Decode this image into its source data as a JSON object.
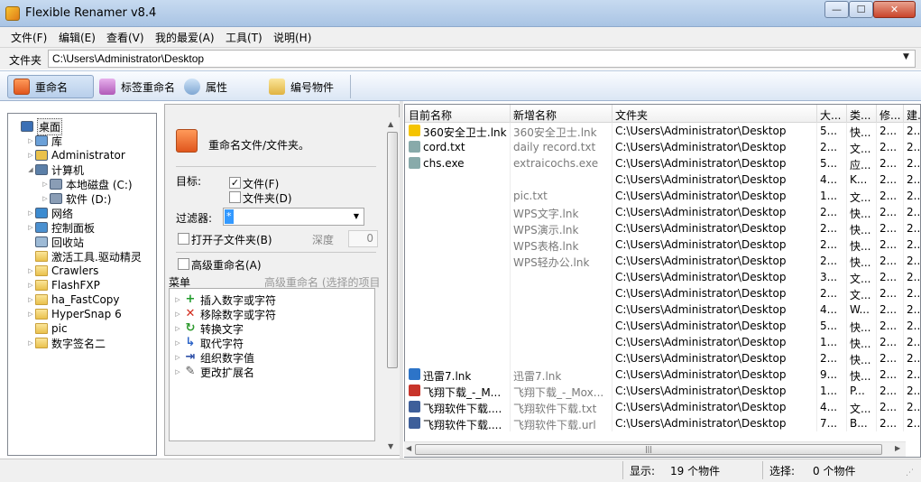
{
  "window": {
    "title": "Flexible Renamer v8.4",
    "min": "—",
    "max": "☐",
    "close": "✕"
  },
  "menu": [
    "文件(F)",
    "编辑(E)",
    "查看(V)",
    "我的最爱(A)",
    "工具(T)",
    "说明(H)"
  ],
  "address": {
    "label": "文件夹",
    "value": "C:\\Users\\Administrator\\Desktop"
  },
  "toolbar": {
    "rename": "重命名",
    "tag_rename": "标签重命名",
    "attributes": "属性",
    "number_items": "编号物件"
  },
  "tree": [
    {
      "label": "桌面",
      "level": 0,
      "expander": "",
      "icon": "desktop-icon"
    },
    {
      "label": "库",
      "level": 1,
      "expander": "▷",
      "icon": "library-icon"
    },
    {
      "label": "Administrator",
      "level": 1,
      "expander": "▷",
      "icon": "user-folder-icon"
    },
    {
      "label": "计算机",
      "level": 1,
      "expander": "◢",
      "icon": "computer-icon"
    },
    {
      "label": "本地磁盘 (C:)",
      "level": 2,
      "expander": "▷",
      "icon": "drive-c-icon"
    },
    {
      "label": "软件 (D:)",
      "level": 2,
      "expander": "▷",
      "icon": "drive-d-icon"
    },
    {
      "label": "网络",
      "level": 1,
      "expander": "▷",
      "icon": "network-icon"
    },
    {
      "label": "控制面板",
      "level": 1,
      "expander": "▷",
      "icon": "control-panel-icon"
    },
    {
      "label": "回收站",
      "level": 1,
      "expander": "",
      "icon": "recycle-bin-icon"
    },
    {
      "label": "激活工具.驱动精灵",
      "level": 1,
      "expander": "",
      "icon": "folder-icon"
    },
    {
      "label": "Crawlers",
      "level": 1,
      "expander": "▷",
      "icon": "folder-icon"
    },
    {
      "label": "FlashFXP",
      "level": 1,
      "expander": "▷",
      "icon": "folder-icon"
    },
    {
      "label": "ha_FastCopy",
      "level": 1,
      "expander": "▷",
      "icon": "folder-icon"
    },
    {
      "label": "HyperSnap 6",
      "level": 1,
      "expander": "▷",
      "icon": "folder-icon"
    },
    {
      "label": "pic",
      "level": 1,
      "expander": "",
      "icon": "folder-icon"
    },
    {
      "label": "数字签名二",
      "level": 1,
      "expander": "▷",
      "icon": "folder-icon"
    }
  ],
  "panel": {
    "heading": "重命名文件/文件夹。",
    "target_label": "目标:",
    "file_option": "文件(F)",
    "file_checked": true,
    "folder_option": "文件夹(D)",
    "folder_checked": false,
    "filter_label": "过滤器:",
    "filter_value": "*",
    "subfolders_label": "打开子文件夹(B)",
    "depth_label": "深度",
    "depth_value": "0",
    "advanced_label": "高级重命名(A)",
    "menu_label": "菜单",
    "menu_hint": "高级重命名 (选择的项目",
    "menu_items": [
      {
        "label": "插入数字或字符",
        "icon": "plus-icon",
        "glyph": "+",
        "color": "#1f9a2a"
      },
      {
        "label": "移除数字或字符",
        "icon": "remove-x-icon",
        "glyph": "✕",
        "color": "#d22b1d"
      },
      {
        "label": "转换文字",
        "icon": "convert-icon",
        "glyph": "↻",
        "color": "#2e9a2e"
      },
      {
        "label": "取代字符",
        "icon": "replace-icon",
        "glyph": "↳",
        "color": "#2d64c8"
      },
      {
        "label": "组织数字值",
        "icon": "organize-icon",
        "glyph": "⇥",
        "color": "#2d4fa8"
      },
      {
        "label": "更改扩展名",
        "icon": "extension-icon",
        "glyph": "✎",
        "color": "#555555"
      }
    ]
  },
  "columns": [
    "目前名称",
    "新增名称",
    "文件夹",
    "大...",
    "类...",
    "修...",
    "建..."
  ],
  "files": [
    {
      "current": "360安全卫士.lnk",
      "new": "360安全卫士.lnk",
      "folder": "C:\\Users\\Administrator\\Desktop",
      "size": "5...",
      "type": "快...",
      "mod": "2...",
      "created": "2..."
    },
    {
      "current": "cord.txt",
      "new": "daily record.txt",
      "folder": "C:\\Users\\Administrator\\Desktop",
      "size": "2...",
      "type": "文...",
      "mod": "2...",
      "created": "2..."
    },
    {
      "current": "chs.exe",
      "new": "extraicochs.exe",
      "folder": "C:\\Users\\Administrator\\Desktop",
      "size": "5...",
      "type": "应...",
      "mod": "2...",
      "created": "2..."
    },
    {
      "current": "",
      "new": "",
      "folder": "C:\\Users\\Administrator\\Desktop",
      "size": "4...",
      "type": "K...",
      "mod": "2...",
      "created": "2..."
    },
    {
      "current": "",
      "new": "pic.txt",
      "folder": "C:\\Users\\Administrator\\Desktop",
      "size": "1...",
      "type": "文...",
      "mod": "2...",
      "created": "2..."
    },
    {
      "current": "",
      "new": "WPS文字.lnk",
      "folder": "C:\\Users\\Administrator\\Desktop",
      "size": "2...",
      "type": "快...",
      "mod": "2...",
      "created": "2..."
    },
    {
      "current": "",
      "new": "WPS演示.lnk",
      "folder": "C:\\Users\\Administrator\\Desktop",
      "size": "2...",
      "type": "快...",
      "mod": "2...",
      "created": "2..."
    },
    {
      "current": "",
      "new": "WPS表格.lnk",
      "folder": "C:\\Users\\Administrator\\Desktop",
      "size": "2...",
      "type": "快...",
      "mod": "2...",
      "created": "2..."
    },
    {
      "current": "",
      "new": "WPS轻办公.lnk",
      "folder": "C:\\Users\\Administrator\\Desktop",
      "size": "2...",
      "type": "快...",
      "mod": "2...",
      "created": "2..."
    },
    {
      "current": "",
      "new": "",
      "folder": "C:\\Users\\Administrator\\Desktop",
      "size": "3...",
      "type": "文...",
      "mod": "2...",
      "created": "2..."
    },
    {
      "current": "",
      "new": "",
      "folder": "C:\\Users\\Administrator\\Desktop",
      "size": "2...",
      "type": "文...",
      "mod": "2...",
      "created": "2..."
    },
    {
      "current": "",
      "new": "",
      "folder": "C:\\Users\\Administrator\\Desktop",
      "size": "4...",
      "type": "W...",
      "mod": "2...",
      "created": "2..."
    },
    {
      "current": "",
      "new": "",
      "folder": "C:\\Users\\Administrator\\Desktop",
      "size": "5...",
      "type": "快...",
      "mod": "2...",
      "created": "2..."
    },
    {
      "current": "",
      "new": "",
      "folder": "C:\\Users\\Administrator\\Desktop",
      "size": "1...",
      "type": "快...",
      "mod": "2...",
      "created": "2..."
    },
    {
      "current": "",
      "new": "",
      "folder": "C:\\Users\\Administrator\\Desktop",
      "size": "2...",
      "type": "快...",
      "mod": "2...",
      "created": "2..."
    },
    {
      "current": "迅雷7.lnk",
      "new": "迅雷7.lnk",
      "folder": "C:\\Users\\Administrator\\Desktop",
      "size": "9...",
      "type": "快...",
      "mod": "2...",
      "created": "2..."
    },
    {
      "current": "飞翔下载_-_M...",
      "new": "飞翔下载_-_Mox...",
      "folder": "C:\\Users\\Administrator\\Desktop",
      "size": "1...",
      "type": "P...",
      "mod": "2...",
      "created": "2..."
    },
    {
      "current": "飞翔软件下载....",
      "new": "飞翔软件下载.txt",
      "folder": "C:\\Users\\Administrator\\Desktop",
      "size": "4...",
      "type": "文...",
      "mod": "2...",
      "created": "2..."
    },
    {
      "current": "飞翔软件下载....",
      "new": "飞翔软件下载.url",
      "folder": "C:\\Users\\Administrator\\Desktop",
      "size": "7...",
      "type": "B...",
      "mod": "2...",
      "created": "2..."
    }
  ],
  "status": {
    "display_label": "显示:",
    "display_value": "19 个物件",
    "select_label": "选择:",
    "select_value": "0 个物件"
  }
}
